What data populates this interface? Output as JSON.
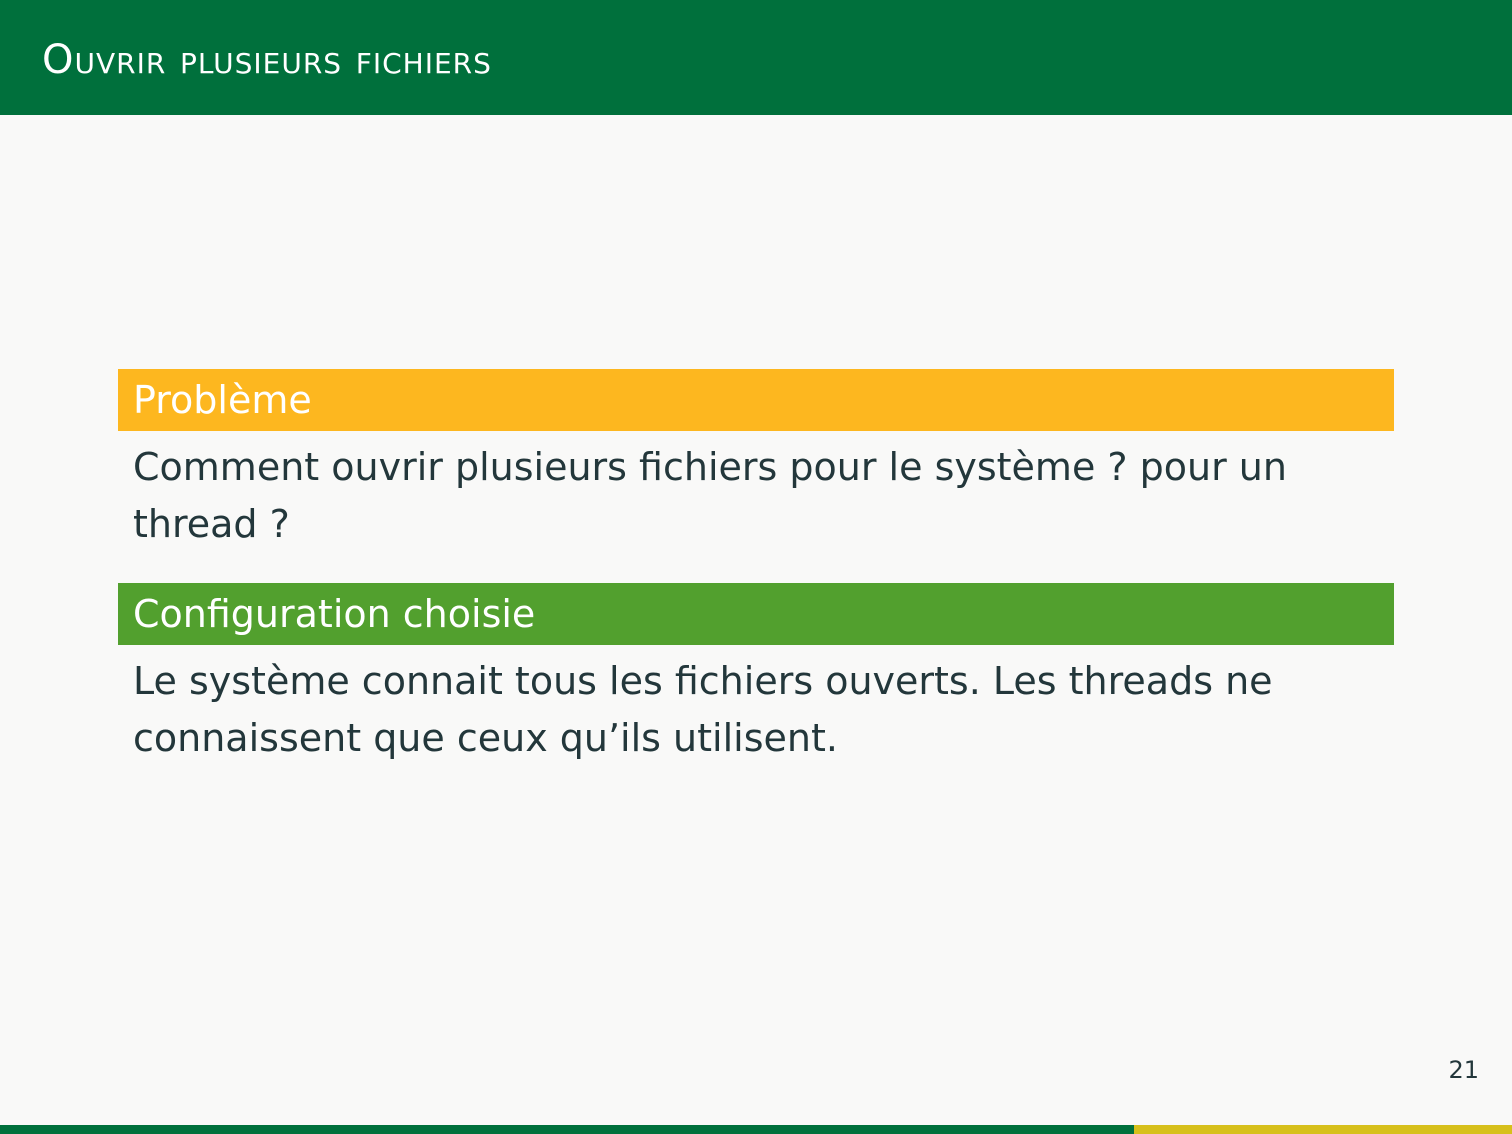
{
  "slide": {
    "title": "Ouvrir plusieurs fichiers",
    "page_number": "21",
    "progress_fraction": 0.75
  },
  "blocks": [
    {
      "title": "Problème",
      "body": "Comment ouvrir plusieurs fichiers pour le système ? pour un thread ?"
    },
    {
      "title": "Configuration choisie",
      "body": "Le système connait tous les fichiers ouverts. Les threads ne connaissent que ceux qu’ils utilisent."
    }
  ],
  "colors": {
    "header": "#00703c",
    "problem_block": "#fdb71f",
    "config_block": "#52a02e",
    "progress_fill": "#00703c",
    "progress_track": "#d7c01b",
    "background": "#f9f9f8",
    "text": "#23373b"
  }
}
